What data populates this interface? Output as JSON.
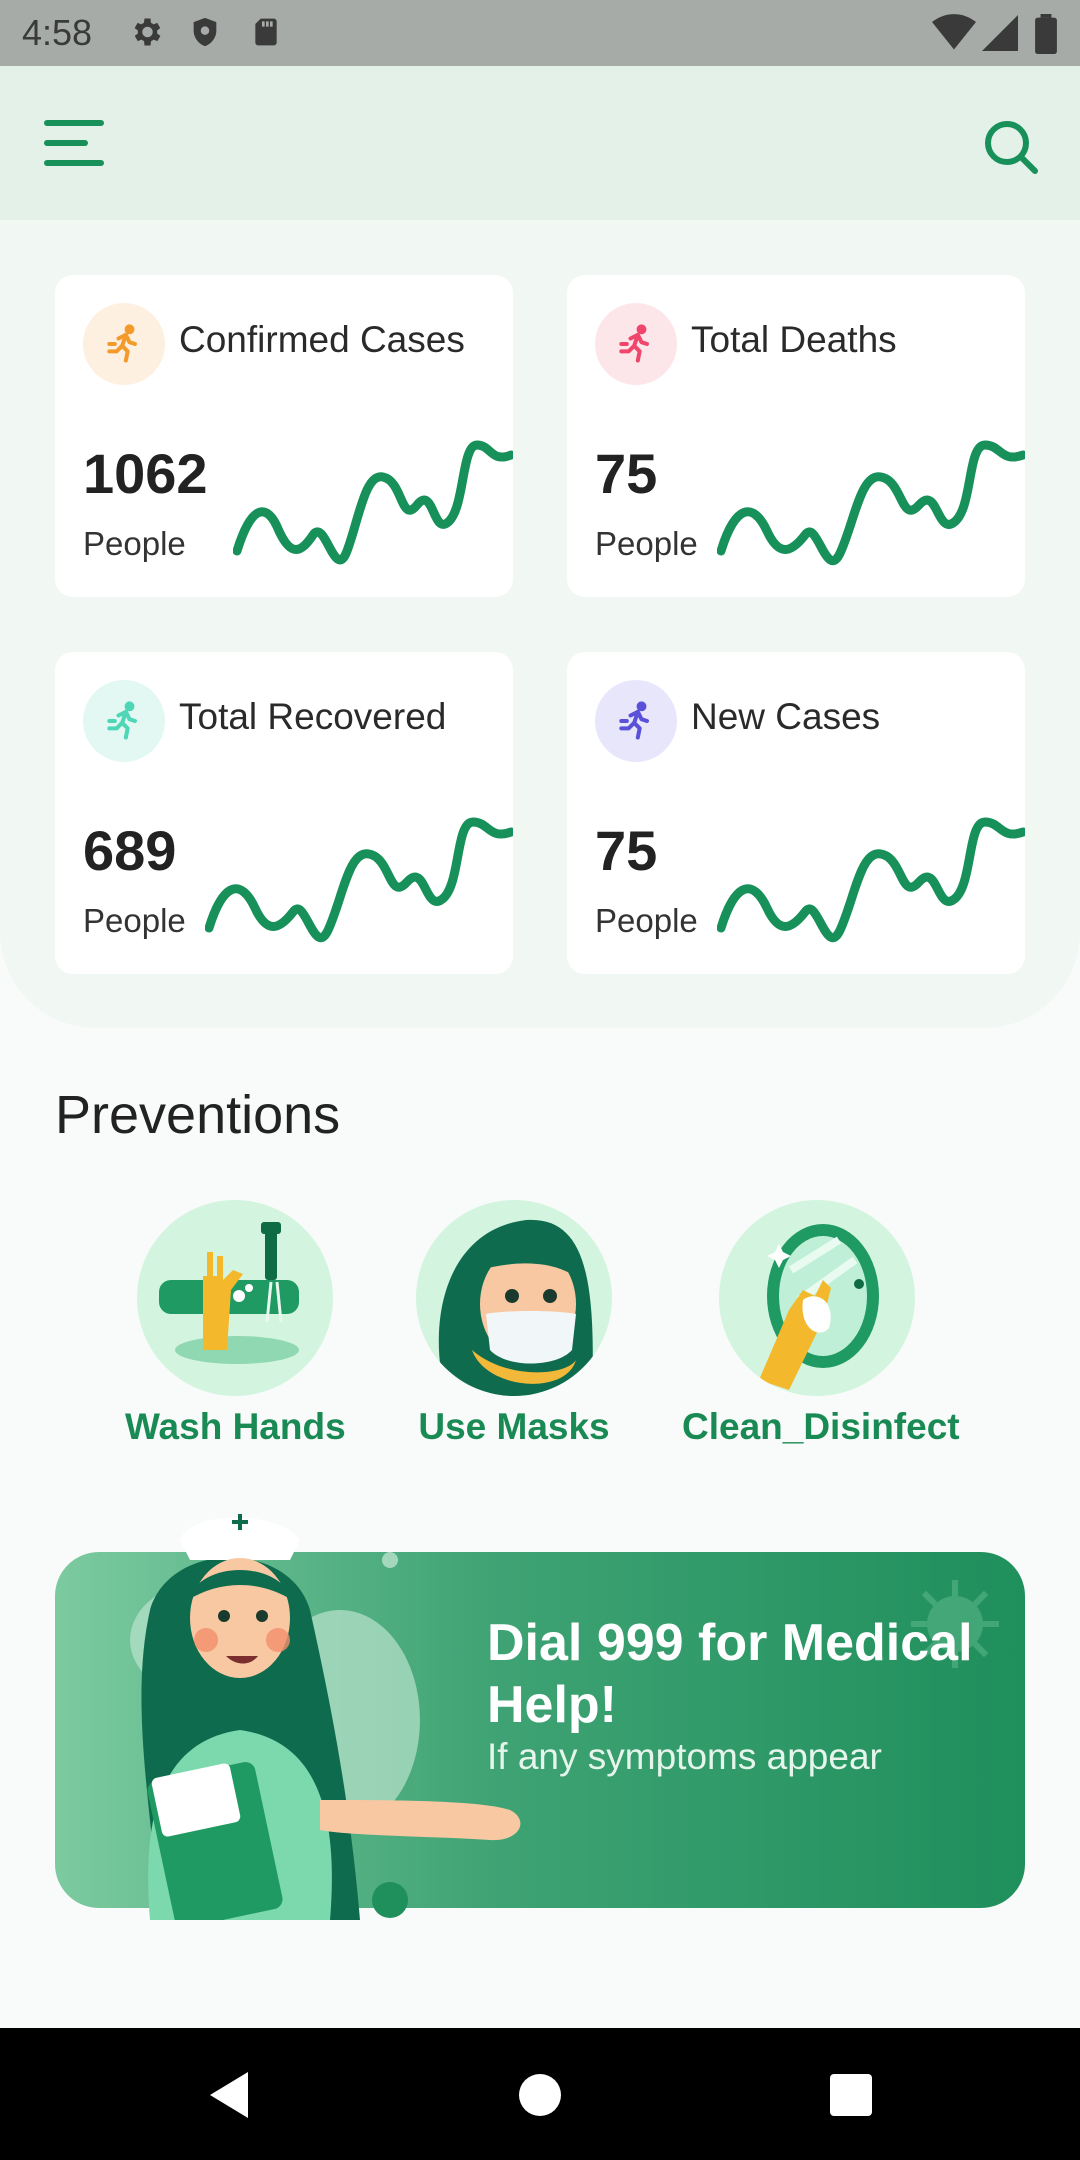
{
  "status_bar": {
    "time": "4:58"
  },
  "app_bar": {
    "menu_icon": "menu-icon",
    "search_icon": "search-icon"
  },
  "stats": [
    {
      "title": "Confirmed Cases",
      "value": "1062",
      "unit": "People",
      "icon": "running-person-icon",
      "icon_color": "#f39a2b",
      "icon_bg": "#fdf0e1"
    },
    {
      "title": "Total Deaths",
      "value": "75",
      "unit": "People",
      "icon": "running-person-icon",
      "icon_color": "#f0466b",
      "icon_bg": "#fde6ea"
    },
    {
      "title": "Total Recovered",
      "value": "689",
      "unit": "People",
      "icon": "running-person-icon",
      "icon_color": "#4fd6b6",
      "icon_bg": "#e3f8f2"
    },
    {
      "title": "New Cases",
      "value": "75",
      "unit": "People",
      "icon": "running-person-icon",
      "icon_color": "#5a51d8",
      "icon_bg": "#e8e6fb"
    }
  ],
  "colors": {
    "accent": "#17905a",
    "sparkline": "#17905a"
  },
  "preventions": {
    "title": "Preventions",
    "items": [
      {
        "label": "Wash Hands"
      },
      {
        "label": "Use Masks"
      },
      {
        "label": "Clean_Disinfect"
      }
    ]
  },
  "banner": {
    "title": "Dial 999 for Medical Help!",
    "subtitle": "If any symptoms appear"
  },
  "nav_bar": {
    "back_icon": "back-icon",
    "home_icon": "home-icon",
    "recents_icon": "recents-icon"
  }
}
